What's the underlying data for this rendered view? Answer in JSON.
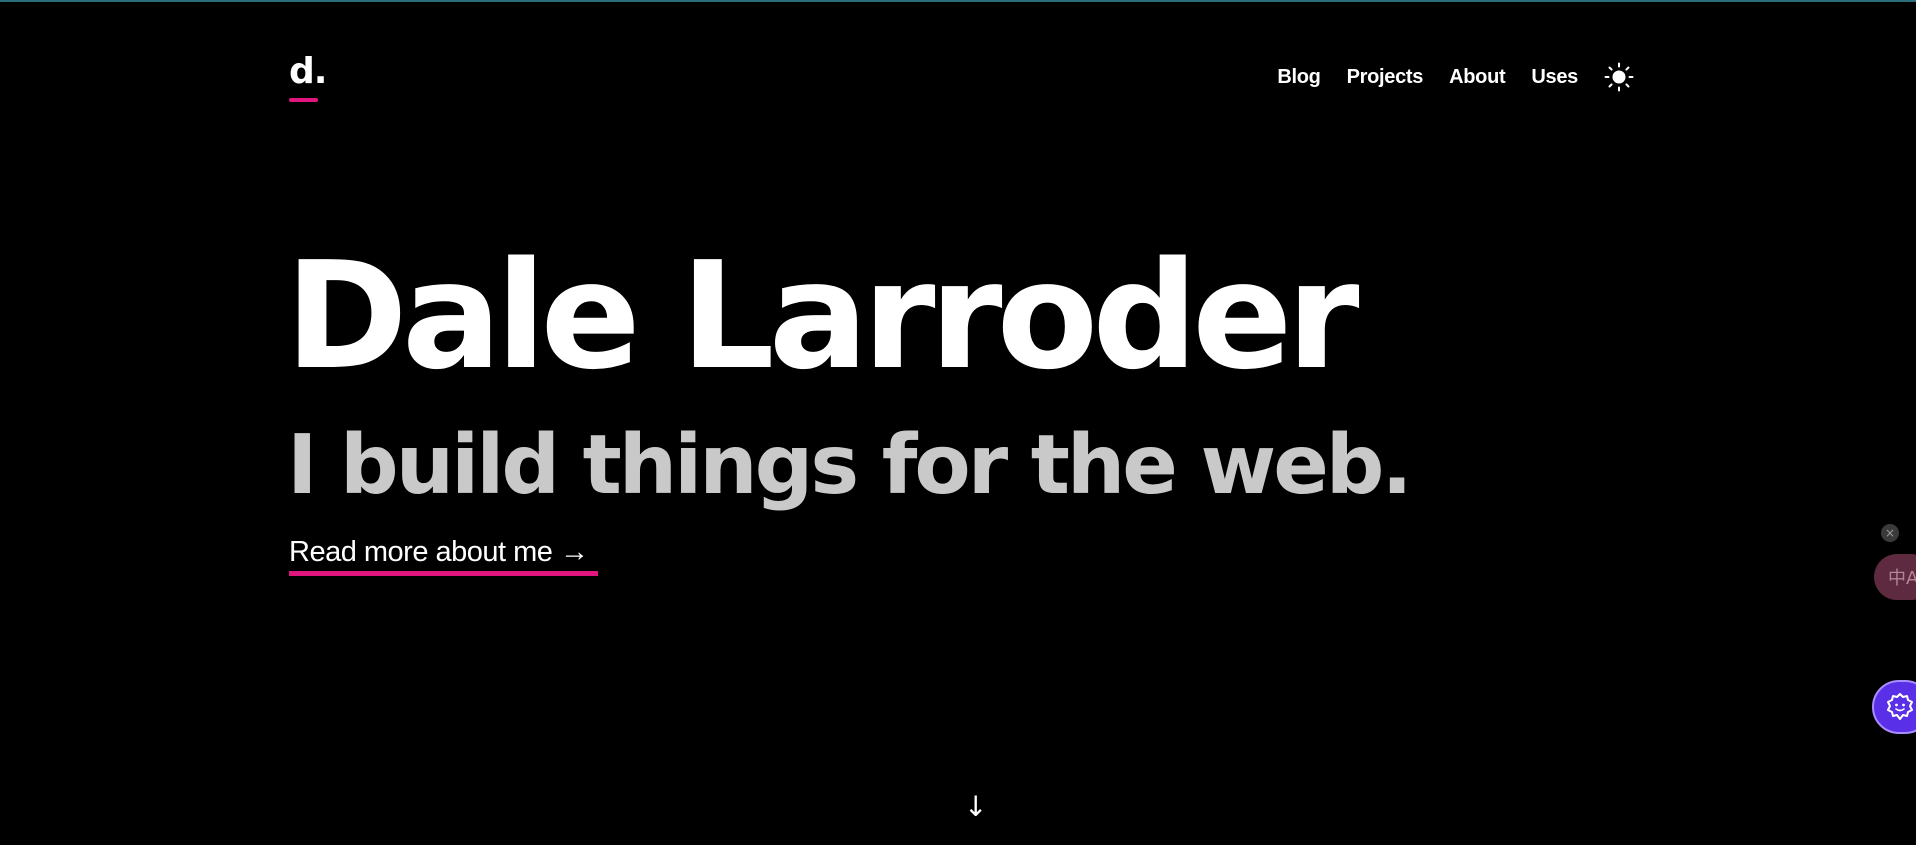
{
  "header": {
    "logo_text": "d.",
    "nav": [
      {
        "label": "Blog"
      },
      {
        "label": "Projects"
      },
      {
        "label": "About"
      },
      {
        "label": "Uses"
      }
    ],
    "theme_toggle_icon": "sun-icon"
  },
  "hero": {
    "name": "Dale Larroder",
    "tagline": "I build things for the web.",
    "read_more": "Read more about me →"
  },
  "scroll_hint": "↓",
  "extensions": {
    "close_glyph": "×",
    "translate_glyph": "中A",
    "translate_icon": "translate-icon",
    "assistant_icon": "gear-face-icon"
  },
  "colors": {
    "background": "#000000",
    "accent": "#e0157d",
    "text": "#ffffff",
    "tagline": "#c9c9c9"
  }
}
